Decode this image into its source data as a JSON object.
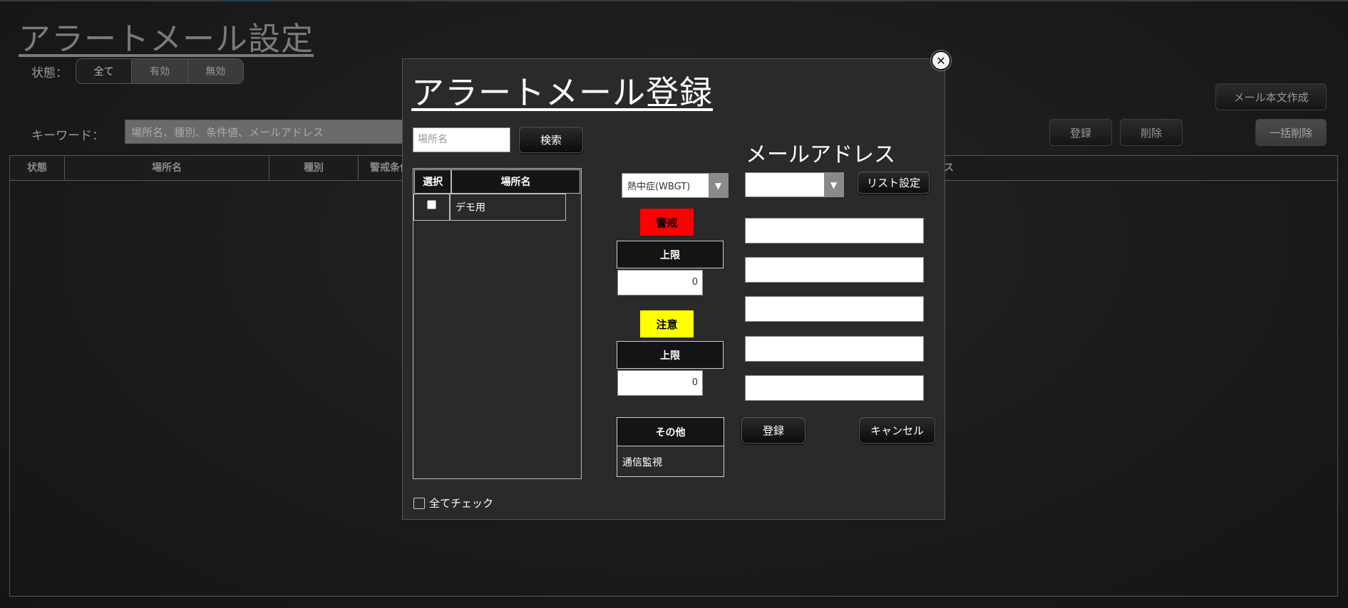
{
  "page": {
    "title": "アラートメール設定",
    "status_label": "状態：",
    "status_options": [
      "全て",
      "有効",
      "無効"
    ],
    "keyword_label": "キーワード：",
    "keyword_placeholder": "場所名、種別、条件値、メールアドレス",
    "buttons": {
      "mail_body": "メール本文作成",
      "register": "登録",
      "delete": "削除",
      "bulk_delete": "一括削除"
    },
    "table_headers": [
      "状態",
      "場所名",
      "種別",
      "警戒条件",
      "ス"
    ]
  },
  "modal": {
    "title": "アラートメール登録",
    "close_icon": "close-icon",
    "search": {
      "placeholder": "場所名",
      "button": "検索"
    },
    "location_table": {
      "headers": [
        "選択",
        "場所名"
      ],
      "rows": [
        {
          "checked": false,
          "name": "デモ用"
        }
      ]
    },
    "check_all_label": "全てチェック",
    "type_select": {
      "value": "熱中症(WBGT)"
    },
    "levels": [
      {
        "name": "警戒",
        "color": "#ff0000",
        "text_color": "#000000",
        "limit_label": "上限",
        "value": "0"
      },
      {
        "name": "注意",
        "color": "#ffff00",
        "text_color": "#000000",
        "limit_label": "上限",
        "value": "0"
      }
    ],
    "other": {
      "header": "その他",
      "item": "通信監視"
    },
    "email": {
      "heading": "メールアドレス",
      "list_select_value": "",
      "list_button": "リスト設定",
      "addresses": [
        "",
        "",
        "",
        "",
        ""
      ]
    },
    "register_button": "登録",
    "cancel_button": "キャンセル"
  }
}
